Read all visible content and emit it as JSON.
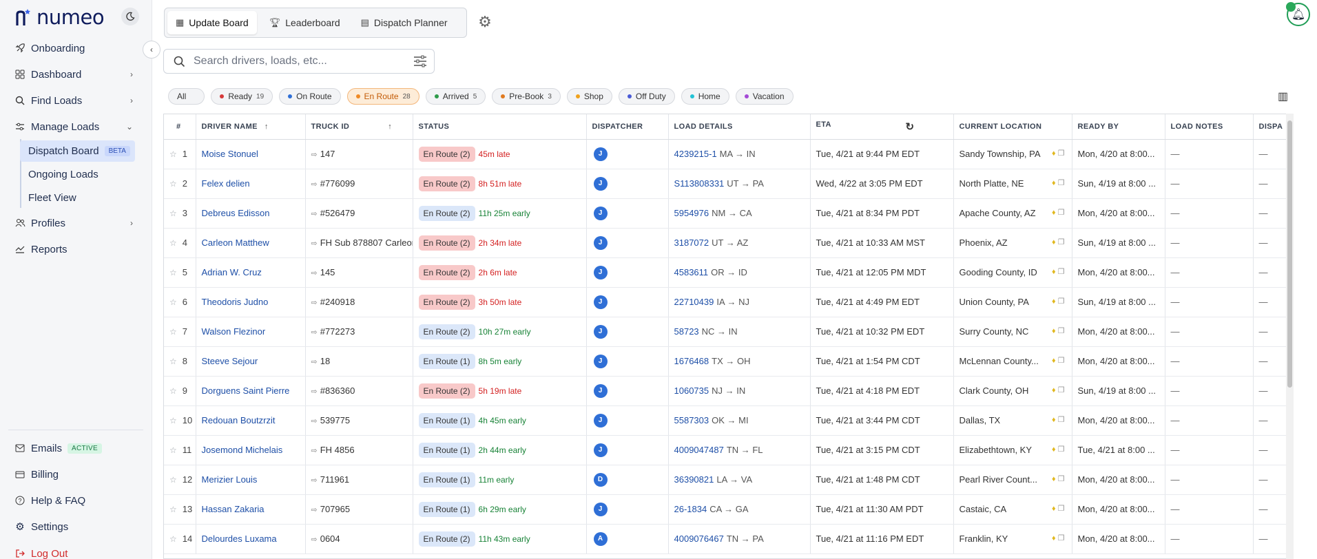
{
  "app": {
    "logo_text": "numeo"
  },
  "sidebar": {
    "items": [
      {
        "label": "Onboarding",
        "icon": "rocket-icon"
      },
      {
        "label": "Dashboard",
        "icon": "grid-icon"
      },
      {
        "label": "Find Loads",
        "icon": "search-icon"
      },
      {
        "label": "Manage Loads",
        "icon": "sliders-icon"
      }
    ],
    "sub_items": [
      {
        "label": "Dispatch Board",
        "badge": "BETA"
      },
      {
        "label": "Ongoing Loads"
      },
      {
        "label": "Fleet View"
      }
    ],
    "items2": [
      {
        "label": "Profiles",
        "icon": "users-icon"
      },
      {
        "label": "Reports",
        "icon": "chart-icon"
      }
    ],
    "bottom": [
      {
        "label": "Emails",
        "badge": "ACTIVE",
        "icon": "mail-icon"
      },
      {
        "label": "Billing",
        "icon": "receipt-icon"
      },
      {
        "label": "Help & FAQ",
        "icon": "help-icon"
      },
      {
        "label": "Settings",
        "icon": "gear-icon"
      },
      {
        "label": "Log Out",
        "icon": "logout-icon"
      }
    ]
  },
  "tabs": [
    {
      "label": "Update Board",
      "icon": "board-icon"
    },
    {
      "label": "Leaderboard",
      "icon": "trophy-icon"
    },
    {
      "label": "Dispatch Planner",
      "icon": "calendar-icon"
    }
  ],
  "search": {
    "placeholder": "Search drivers, loads, etc..."
  },
  "chips": [
    {
      "label": "All",
      "count": "",
      "color": ""
    },
    {
      "label": "Ready",
      "count": "19",
      "color": "#d63a3a"
    },
    {
      "label": "On Route",
      "count": "",
      "color": "#2f6fd6"
    },
    {
      "label": "En Route",
      "count": "28",
      "color": "#f08a24"
    },
    {
      "label": "Arrived",
      "count": "5",
      "color": "#2e9b4a"
    },
    {
      "label": "Pre-Book",
      "count": "3",
      "color": "#e07a1f"
    },
    {
      "label": "Shop",
      "count": "",
      "color": "#f0a21d"
    },
    {
      "label": "Off Duty",
      "count": "",
      "color": "#4a5bd6"
    },
    {
      "label": "Home",
      "count": "",
      "color": "#22c3d6"
    },
    {
      "label": "Vacation",
      "count": "",
      "color": "#a44ad6"
    }
  ],
  "table": {
    "headers": [
      "#",
      "DRIVER NAME",
      "TRUCK ID",
      "STATUS",
      "DISPATCHER",
      "LOAD DETAILS",
      "ETA",
      "CURRENT LOCATION",
      "READY BY",
      "LOAD NOTES",
      "DISPA"
    ],
    "rows": [
      {
        "n": "1",
        "driver": "Moise Stonuel",
        "truck": "147",
        "status": "En Route (2)",
        "kind": "r2",
        "delta": "45m late",
        "late": true,
        "disp": "J",
        "load": "4239215-1",
        "route": "MA → IN",
        "eta": "Tue, 4/21 at 9:44 PM EDT",
        "loc": "Sandy Township, PA",
        "ready": "Mon, 4/20 at 8:00...",
        "notes": "—",
        "dispa": "—"
      },
      {
        "n": "2",
        "driver": "Felex delien",
        "truck": "#776099",
        "status": "En Route (2)",
        "kind": "r2",
        "delta": "8h 51m late",
        "late": true,
        "disp": "J",
        "load": "S113808331",
        "route": "UT → PA",
        "eta": "Wed, 4/22 at 3:05 PM EDT",
        "loc": "North Platte, NE",
        "ready": "Sun, 4/19 at 8:00 ...",
        "notes": "—",
        "dispa": "—"
      },
      {
        "n": "3",
        "driver": "Debreus Edisson",
        "truck": "#526479",
        "status": "En Route (2)",
        "kind": "r1",
        "delta": "11h 25m early",
        "late": false,
        "disp": "J",
        "load": "5954976",
        "route": "NM → CA",
        "eta": "Tue, 4/21 at 8:34 PM PDT",
        "loc": "Apache County, AZ",
        "ready": "Mon, 4/20 at 8:00...",
        "notes": "—",
        "dispa": "—"
      },
      {
        "n": "4",
        "driver": "Carleon Matthew",
        "truck": "FH Sub 878807 Carleon",
        "status": "En Route (2)",
        "kind": "r2",
        "delta": "2h 34m late",
        "late": true,
        "disp": "J",
        "load": "3187072",
        "route": "UT → AZ",
        "eta": "Tue, 4/21 at 10:33 AM MST",
        "loc": "Phoenix, AZ",
        "ready": "Sun, 4/19 at 8:00 ...",
        "notes": "—",
        "dispa": "—"
      },
      {
        "n": "5",
        "driver": "Adrian W. Cruz",
        "truck": "145",
        "status": "En Route (2)",
        "kind": "r2",
        "delta": "2h 6m late",
        "late": true,
        "disp": "J",
        "load": "4583611",
        "route": "OR → ID",
        "eta": "Tue, 4/21 at 12:05 PM MDT",
        "loc": "Gooding County, ID",
        "ready": "Mon, 4/20 at 8:00...",
        "notes": "—",
        "dispa": "—"
      },
      {
        "n": "6",
        "driver": "Theodoris Judno",
        "truck": "#240918",
        "status": "En Route (2)",
        "kind": "r2",
        "delta": "3h 50m late",
        "late": true,
        "disp": "J",
        "load": "22710439",
        "route": "IA → NJ",
        "eta": "Tue, 4/21 at 4:49 PM EDT",
        "loc": "Union County, PA",
        "ready": "Sun, 4/19 at 8:00 ...",
        "notes": "—",
        "dispa": "—"
      },
      {
        "n": "7",
        "driver": "Walson Flezinor",
        "truck": "#772273",
        "status": "En Route (2)",
        "kind": "r1",
        "delta": "10h 27m early",
        "late": false,
        "disp": "J",
        "load": "58723",
        "route": "NC → IN",
        "eta": "Tue, 4/21 at 10:32 PM EDT",
        "loc": "Surry County, NC",
        "ready": "Mon, 4/20 at 8:00...",
        "notes": "—",
        "dispa": "—"
      },
      {
        "n": "8",
        "driver": "Steeve Sejour",
        "truck": "18",
        "status": "En Route (1)",
        "kind": "r1",
        "delta": "8h 5m early",
        "late": false,
        "disp": "J",
        "load": "1676468",
        "route": "TX → OH",
        "eta": "Tue, 4/21 at 1:54 PM CDT",
        "loc": "McLennan County...",
        "ready": "Mon, 4/20 at 8:00...",
        "notes": "—",
        "dispa": "—"
      },
      {
        "n": "9",
        "driver": "Dorguens Saint Pierre",
        "truck": "#836360",
        "status": "En Route (2)",
        "kind": "r2",
        "delta": "5h 19m late",
        "late": true,
        "disp": "J",
        "load": "1060735",
        "route": "NJ → IN",
        "eta": "Tue, 4/21 at 4:18 PM EDT",
        "loc": "Clark County, OH",
        "ready": "Sun, 4/19 at 8:00 ...",
        "notes": "—",
        "dispa": "—"
      },
      {
        "n": "10",
        "driver": "Redouan Boutzrzit",
        "truck": "539775",
        "status": "En Route (1)",
        "kind": "r1",
        "delta": "4h 45m early",
        "late": false,
        "disp": "J",
        "load": "5587303",
        "route": "OK → MI",
        "eta": "Tue, 4/21 at 3:44 PM CDT",
        "loc": "Dallas, TX",
        "ready": "Mon, 4/20 at 8:00...",
        "notes": "—",
        "dispa": "—"
      },
      {
        "n": "11",
        "driver": "Josemond Michelais",
        "truck": "FH 4856",
        "status": "En Route (1)",
        "kind": "r1",
        "delta": "2h 44m early",
        "late": false,
        "disp": "J",
        "load": "4009047487",
        "route": "TN → FL",
        "eta": "Tue, 4/21 at 3:15 PM CDT",
        "loc": "Elizabethtown, KY",
        "ready": "Tue, 4/21 at 8:00 ...",
        "notes": "—",
        "dispa": "—"
      },
      {
        "n": "12",
        "driver": "Merizier Louis",
        "truck": "711961",
        "status": "En Route (1)",
        "kind": "r1",
        "delta": "11m early",
        "late": false,
        "disp": "D",
        "load": "36390821",
        "route": "LA → VA",
        "eta": "Tue, 4/21 at 1:48 PM CDT",
        "loc": "Pearl River Count...",
        "ready": "Mon, 4/20 at 8:00...",
        "notes": "—",
        "dispa": "—"
      },
      {
        "n": "13",
        "driver": "Hassan Zakaria",
        "truck": "707965",
        "status": "En Route (1)",
        "kind": "r1",
        "delta": "6h 29m early",
        "late": false,
        "disp": "J",
        "load": "26-1834",
        "route": "CA → GA",
        "eta": "Tue, 4/21 at 11:30 AM PDT",
        "loc": "Castaic, CA",
        "ready": "Mon, 4/20 at 8:00...",
        "notes": "—",
        "dispa": "—"
      },
      {
        "n": "14",
        "driver": "Delourdes Luxama",
        "truck": "0604",
        "status": "En Route (2)",
        "kind": "r1",
        "delta": "11h 43m early",
        "late": false,
        "disp": "A",
        "load": "4009076467",
        "route": "TN → PA",
        "eta": "Tue, 4/21 at 11:16 PM EDT",
        "loc": "Franklin, KY",
        "ready": "Mon, 4/20 at 8:00...",
        "notes": "—",
        "dispa": "—"
      }
    ]
  }
}
